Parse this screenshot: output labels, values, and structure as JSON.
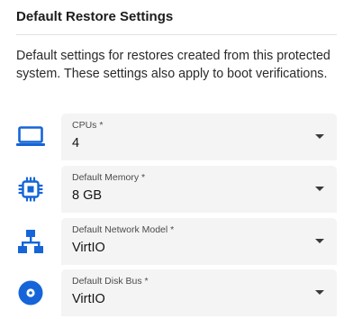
{
  "section": {
    "title": "Default Restore Settings",
    "description": "Default settings for restores created from this protected system. These settings also apply to boot verifications."
  },
  "fields": [
    {
      "icon": "laptop-icon",
      "label": "CPUs",
      "required_mark": "*",
      "value": "4"
    },
    {
      "icon": "memory-chip-icon",
      "label": "Default Memory",
      "required_mark": "*",
      "value": "8 GB"
    },
    {
      "icon": "network-hierarchy-icon",
      "label": "Default Network Model",
      "required_mark": "*",
      "value": "VirtIO"
    },
    {
      "icon": "disk-icon",
      "label": "Default Disk Bus",
      "required_mark": "*",
      "value": "VirtIO"
    }
  ],
  "colors": {
    "accent": "#1565d8",
    "field_background": "#f4f4f4",
    "divider": "#e2e2e2"
  }
}
